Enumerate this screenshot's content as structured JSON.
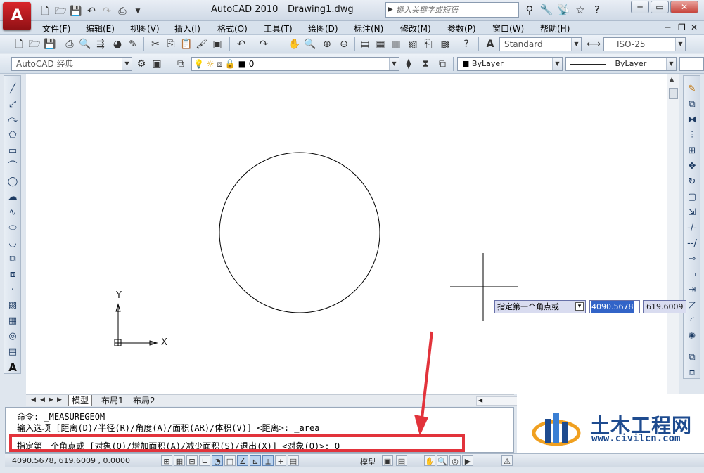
{
  "window": {
    "app_title": "AutoCAD 2010",
    "file_name": "Drawing1.dwg",
    "search_placeholder": "键入关键字或短语",
    "app_logo_letter": "A"
  },
  "menu": [
    "文件(F)",
    "编辑(E)",
    "视图(V)",
    "插入(I)",
    "格式(O)",
    "工具(T)",
    "绘图(D)",
    "标注(N)",
    "修改(M)",
    "参数(P)",
    "窗口(W)",
    "帮助(H)"
  ],
  "toolbar": {
    "text_style": "Standard",
    "dim_style": "ISO-25",
    "workspace": "AutoCAD 经典",
    "layer": "0",
    "color": "ByLayer",
    "linetype": "ByLayer"
  },
  "ucs": {
    "x_label": "X",
    "y_label": "Y"
  },
  "layout_tabs": [
    "模型",
    "布局1",
    "布局2"
  ],
  "dynamic_input": {
    "prompt": "指定第一个角点或",
    "x_value": "4090.5678",
    "y_value": "619.6009"
  },
  "command_lines": [
    "命令:  _MEASUREGEOM",
    "输入选项 [距离(D)/半径(R)/角度(A)/面积(AR)/体积(V)] <距离>: _area",
    "指定第一个角点或 [对象(O)/增加面积(A)/减少面积(S)/退出(X)] <对象(O)>: O"
  ],
  "status": {
    "coordinates": "4090.5678, 619.6009 , 0.0000",
    "model_label": "模型"
  },
  "watermark": {
    "name": "土木工程网",
    "url": "www.civilcn.com"
  },
  "colors": {
    "highlight_border": "#e2333b",
    "annotation_arrow": "#e2333b",
    "watermark_blue": "#1e4b8f"
  }
}
